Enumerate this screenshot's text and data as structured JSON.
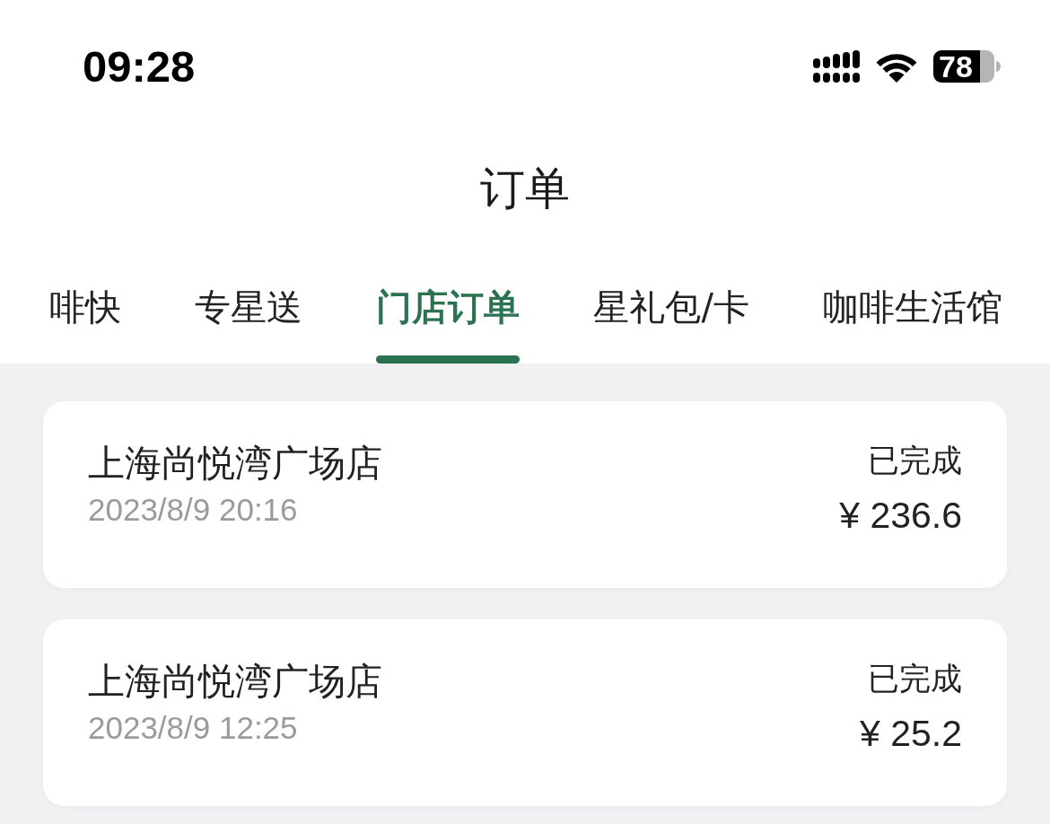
{
  "status_bar": {
    "time": "09:28",
    "battery": "78"
  },
  "header": {
    "title": "订单"
  },
  "tabs": [
    {
      "label": "啡快",
      "selected": false
    },
    {
      "label": "专星送",
      "selected": false
    },
    {
      "label": "门店订单",
      "selected": true
    },
    {
      "label": "星礼包/卡",
      "selected": false
    },
    {
      "label": "咖啡生活馆",
      "selected": false
    }
  ],
  "orders": [
    {
      "store": "上海尚悦湾广场店",
      "datetime": "2023/8/9 20:16",
      "status": "已完成",
      "amount": "¥ 236.6"
    },
    {
      "store": "上海尚悦湾广场店",
      "datetime": "2023/8/9 12:25",
      "status": "已完成",
      "amount": "¥ 25.2"
    }
  ]
}
